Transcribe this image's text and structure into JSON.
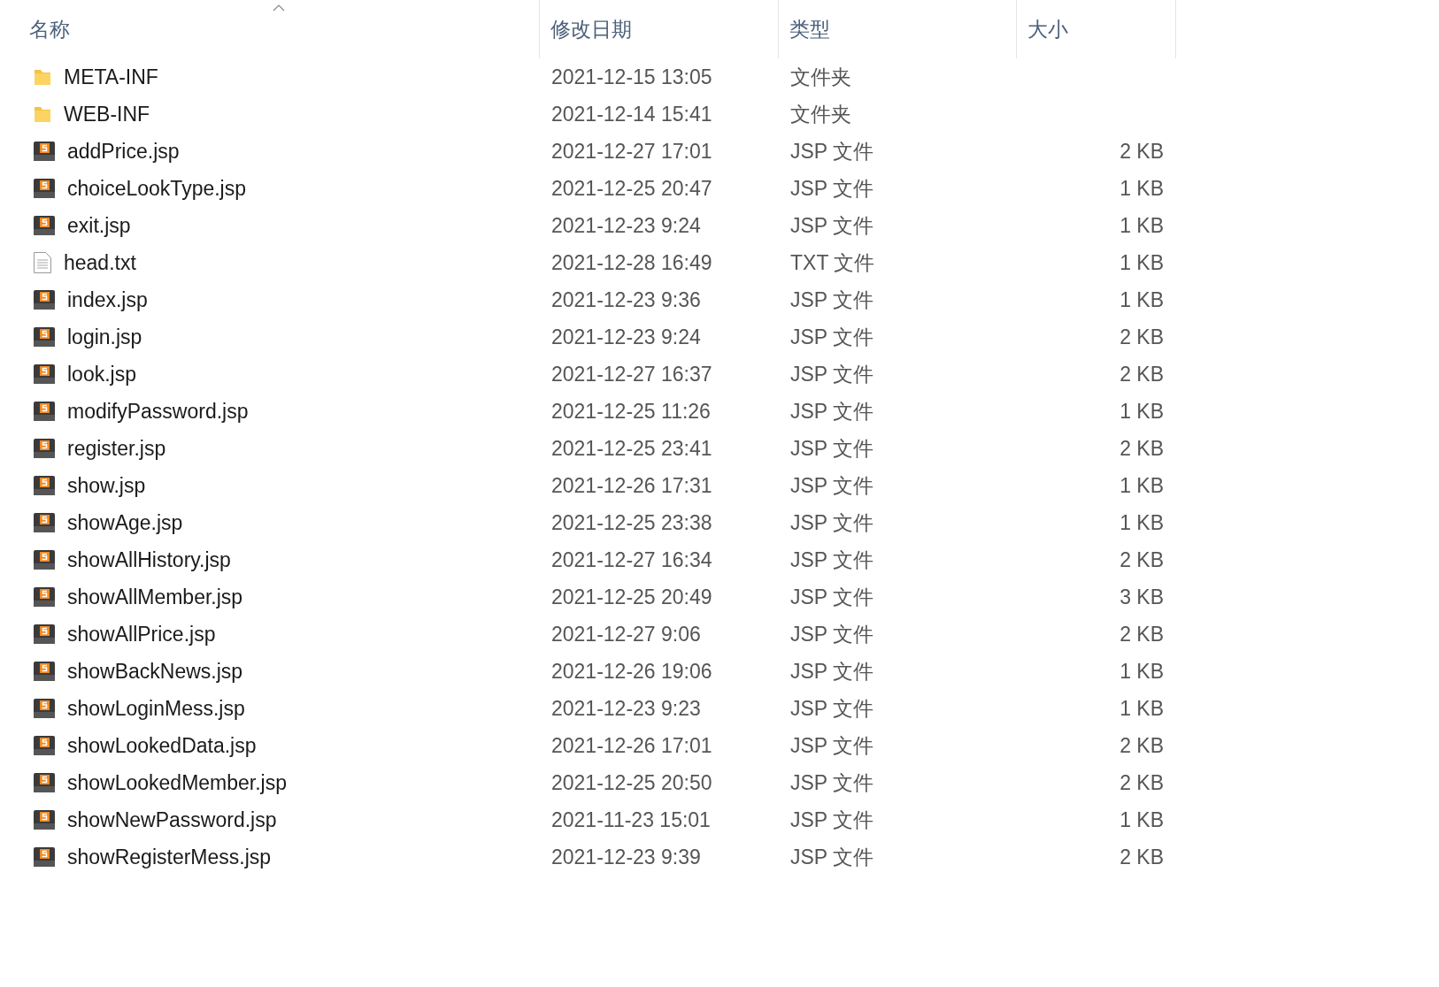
{
  "columns": [
    {
      "label": "名称",
      "sorted": true
    },
    {
      "label": "修改日期",
      "sorted": false
    },
    {
      "label": "类型",
      "sorted": false
    },
    {
      "label": "大小",
      "sorted": false
    }
  ],
  "rows": [
    {
      "kind": "folder",
      "name": "META-INF",
      "date": "2021-12-15 13:05",
      "type": "文件夹"
    },
    {
      "kind": "folder",
      "name": "WEB-INF",
      "date": "2021-12-14 15:41",
      "type": "文件夹"
    },
    {
      "kind": "jsp",
      "name": "addPrice.jsp",
      "date": "2021-12-27 17:01",
      "type": "JSP 文件",
      "size": "2 KB"
    },
    {
      "kind": "jsp",
      "name": "choiceLookType.jsp",
      "date": "2021-12-25 20:47",
      "type": "JSP 文件",
      "size": "1 KB"
    },
    {
      "kind": "jsp",
      "name": "exit.jsp",
      "date": "2021-12-23 9:24",
      "type": "JSP 文件",
      "size": "1 KB"
    },
    {
      "kind": "txt",
      "name": "head.txt",
      "date": "2021-12-28 16:49",
      "type": "TXT 文件",
      "size": "1 KB"
    },
    {
      "kind": "jsp",
      "name": "index.jsp",
      "date": "2021-12-23 9:36",
      "type": "JSP 文件",
      "size": "1 KB"
    },
    {
      "kind": "jsp",
      "name": "login.jsp",
      "date": "2021-12-23 9:24",
      "type": "JSP 文件",
      "size": "2 KB"
    },
    {
      "kind": "jsp",
      "name": "look.jsp",
      "date": "2021-12-27 16:37",
      "type": "JSP 文件",
      "size": "2 KB"
    },
    {
      "kind": "jsp",
      "name": "modifyPassword.jsp",
      "date": "2021-12-25 11:26",
      "type": "JSP 文件",
      "size": "1 KB"
    },
    {
      "kind": "jsp",
      "name": "register.jsp",
      "date": "2021-12-25 23:41",
      "type": "JSP 文件",
      "size": "2 KB"
    },
    {
      "kind": "jsp",
      "name": "show.jsp",
      "date": "2021-12-26 17:31",
      "type": "JSP 文件",
      "size": "1 KB"
    },
    {
      "kind": "jsp",
      "name": "showAge.jsp",
      "date": "2021-12-25 23:38",
      "type": "JSP 文件",
      "size": "1 KB"
    },
    {
      "kind": "jsp",
      "name": "showAllHistory.jsp",
      "date": "2021-12-27 16:34",
      "type": "JSP 文件",
      "size": "2 KB"
    },
    {
      "kind": "jsp",
      "name": "showAllMember.jsp",
      "date": "2021-12-25 20:49",
      "type": "JSP 文件",
      "size": "3 KB"
    },
    {
      "kind": "jsp",
      "name": "showAllPrice.jsp",
      "date": "2021-12-27 9:06",
      "type": "JSP 文件",
      "size": "2 KB"
    },
    {
      "kind": "jsp",
      "name": "showBackNews.jsp",
      "date": "2021-12-26 19:06",
      "type": "JSP 文件",
      "size": "1 KB"
    },
    {
      "kind": "jsp",
      "name": "showLoginMess.jsp",
      "date": "2021-12-23 9:23",
      "type": "JSP 文件",
      "size": "1 KB"
    },
    {
      "kind": "jsp",
      "name": "showLookedData.jsp",
      "date": "2021-12-26 17:01",
      "type": "JSP 文件",
      "size": "2 KB"
    },
    {
      "kind": "jsp",
      "name": "showLookedMember.jsp",
      "date": "2021-12-25 20:50",
      "type": "JSP 文件",
      "size": "2 KB"
    },
    {
      "kind": "jsp",
      "name": "showNewPassword.jsp",
      "date": "2021-11-23 15:01",
      "type": "JSP 文件",
      "size": "1 KB"
    },
    {
      "kind": "jsp",
      "name": "showRegisterMess.jsp",
      "date": "2021-12-23 9:39",
      "type": "JSP 文件",
      "size": "2 KB"
    }
  ]
}
